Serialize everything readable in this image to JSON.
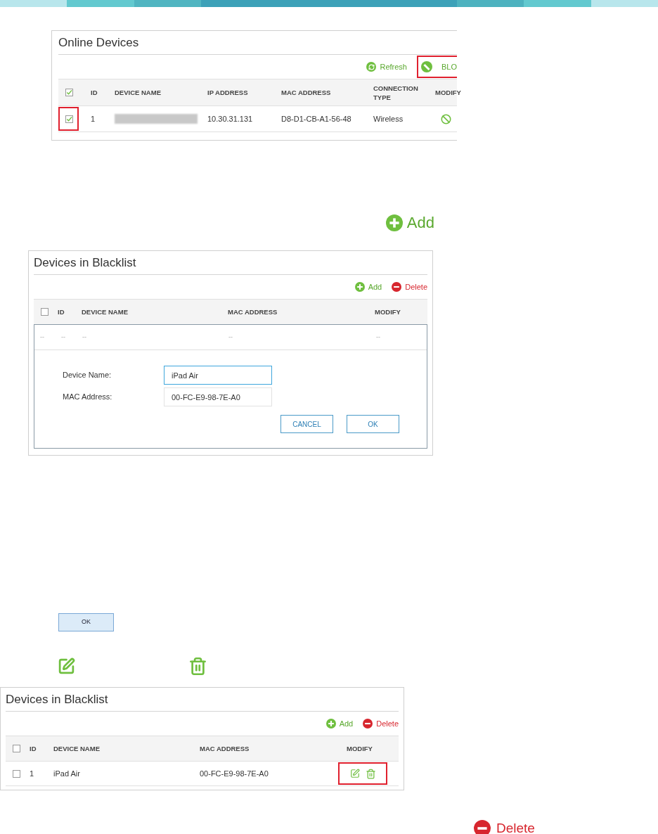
{
  "online_devices": {
    "title": "Online Devices",
    "toolbar": [
      {
        "kind": "refresh",
        "label": "Refresh"
      },
      {
        "kind": "block",
        "label": "BLO"
      }
    ],
    "columns": [
      "ID",
      "DEVICE NAME",
      "IP ADDRESS",
      "MAC ADDRESS",
      "CONNECTION TYPE",
      "MODIFY"
    ],
    "header_checked": true,
    "rows": [
      {
        "checked": true,
        "id": "1",
        "ip_address": "10.30.31.131",
        "mac_address": "D8-D1-CB-A1-56-48",
        "connection_type": "Wireless"
      }
    ]
  },
  "add_label": "Add",
  "blacklist_form": {
    "title": "Devices in Blacklist",
    "toolbar": [
      {
        "kind": "add",
        "label": "Add"
      },
      {
        "kind": "delete",
        "label": "Delete"
      }
    ],
    "columns": [
      "ID",
      "DEVICE NAME",
      "MAC ADDRESS",
      "MODIFY"
    ],
    "header_checked": false,
    "empty_row": [
      "--",
      "--",
      "--",
      "--",
      "--"
    ],
    "fields": [
      {
        "label": "Device Name:",
        "value": "iPad Air",
        "focused": true
      },
      {
        "label": "MAC Address:",
        "value": "00-FC-E9-98-7E-A0",
        "focused": false
      }
    ],
    "buttons": [
      "CANCEL",
      "OK"
    ]
  },
  "ok_label": "OK",
  "blacklist": {
    "title": "Devices in Blacklist",
    "toolbar": [
      {
        "kind": "add",
        "label": "Add"
      },
      {
        "kind": "delete",
        "label": "Delete"
      }
    ],
    "columns": [
      "ID",
      "DEVICE NAME",
      "MAC ADDRESS",
      "MODIFY"
    ],
    "header_checked": false,
    "rows": [
      {
        "checked": false,
        "id": "1",
        "device_name": "iPad Air",
        "mac_address": "00-FC-E9-98-7E-A0"
      }
    ]
  },
  "delete_label": "Delete"
}
